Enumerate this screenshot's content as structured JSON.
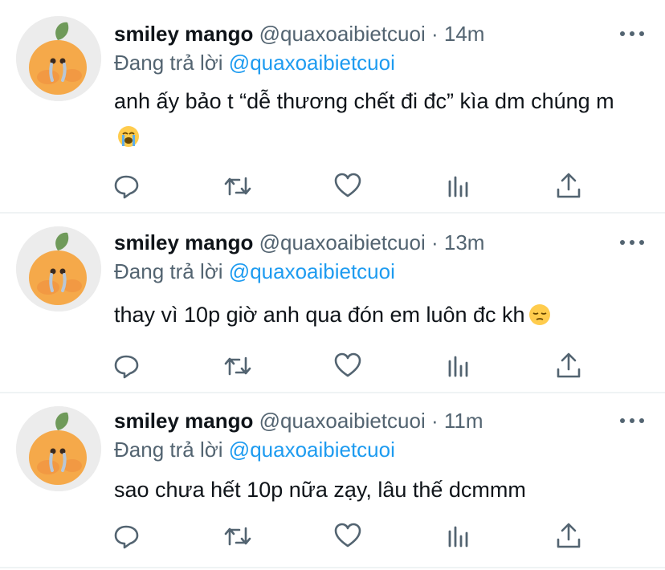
{
  "tweets": [
    {
      "display_name": "smiley mango",
      "handle": "@quaxoaibietcuoi",
      "separator": "·",
      "time": "14m",
      "reply_prefix": "Đang trả lời",
      "reply_to": "@quaxoaibietcuoi",
      "text": "anh ấy bảo t “dễ thương chết đi đc” kìa dm chúng m",
      "emoji": "loudly-crying-face"
    },
    {
      "display_name": "smiley mango",
      "handle": "@quaxoaibietcuoi",
      "separator": "·",
      "time": "13m",
      "reply_prefix": "Đang trả lời",
      "reply_to": "@quaxoaibietcuoi",
      "text": "thay vì 10p giờ anh qua đón em luôn đc kh",
      "emoji": "pensive-face"
    },
    {
      "display_name": "smiley mango",
      "handle": "@quaxoaibietcuoi",
      "separator": "·",
      "time": "11m",
      "reply_prefix": "Đang trả lời",
      "reply_to": "@quaxoaibietcuoi",
      "text": "sao chưa hết 10p nữa zạy, lâu thế dcmmm",
      "emoji": ""
    }
  ],
  "colors": {
    "name": "#0f1419",
    "secondary": "#536471",
    "link": "#1d9bf0",
    "divider": "#eff3f4",
    "avatar_fruit": "#f5a94a",
    "avatar_leaf": "#6f9a5a"
  },
  "icons": [
    "reply-icon",
    "retweet-icon",
    "like-icon",
    "analytics-icon",
    "share-icon",
    "more-icon"
  ]
}
